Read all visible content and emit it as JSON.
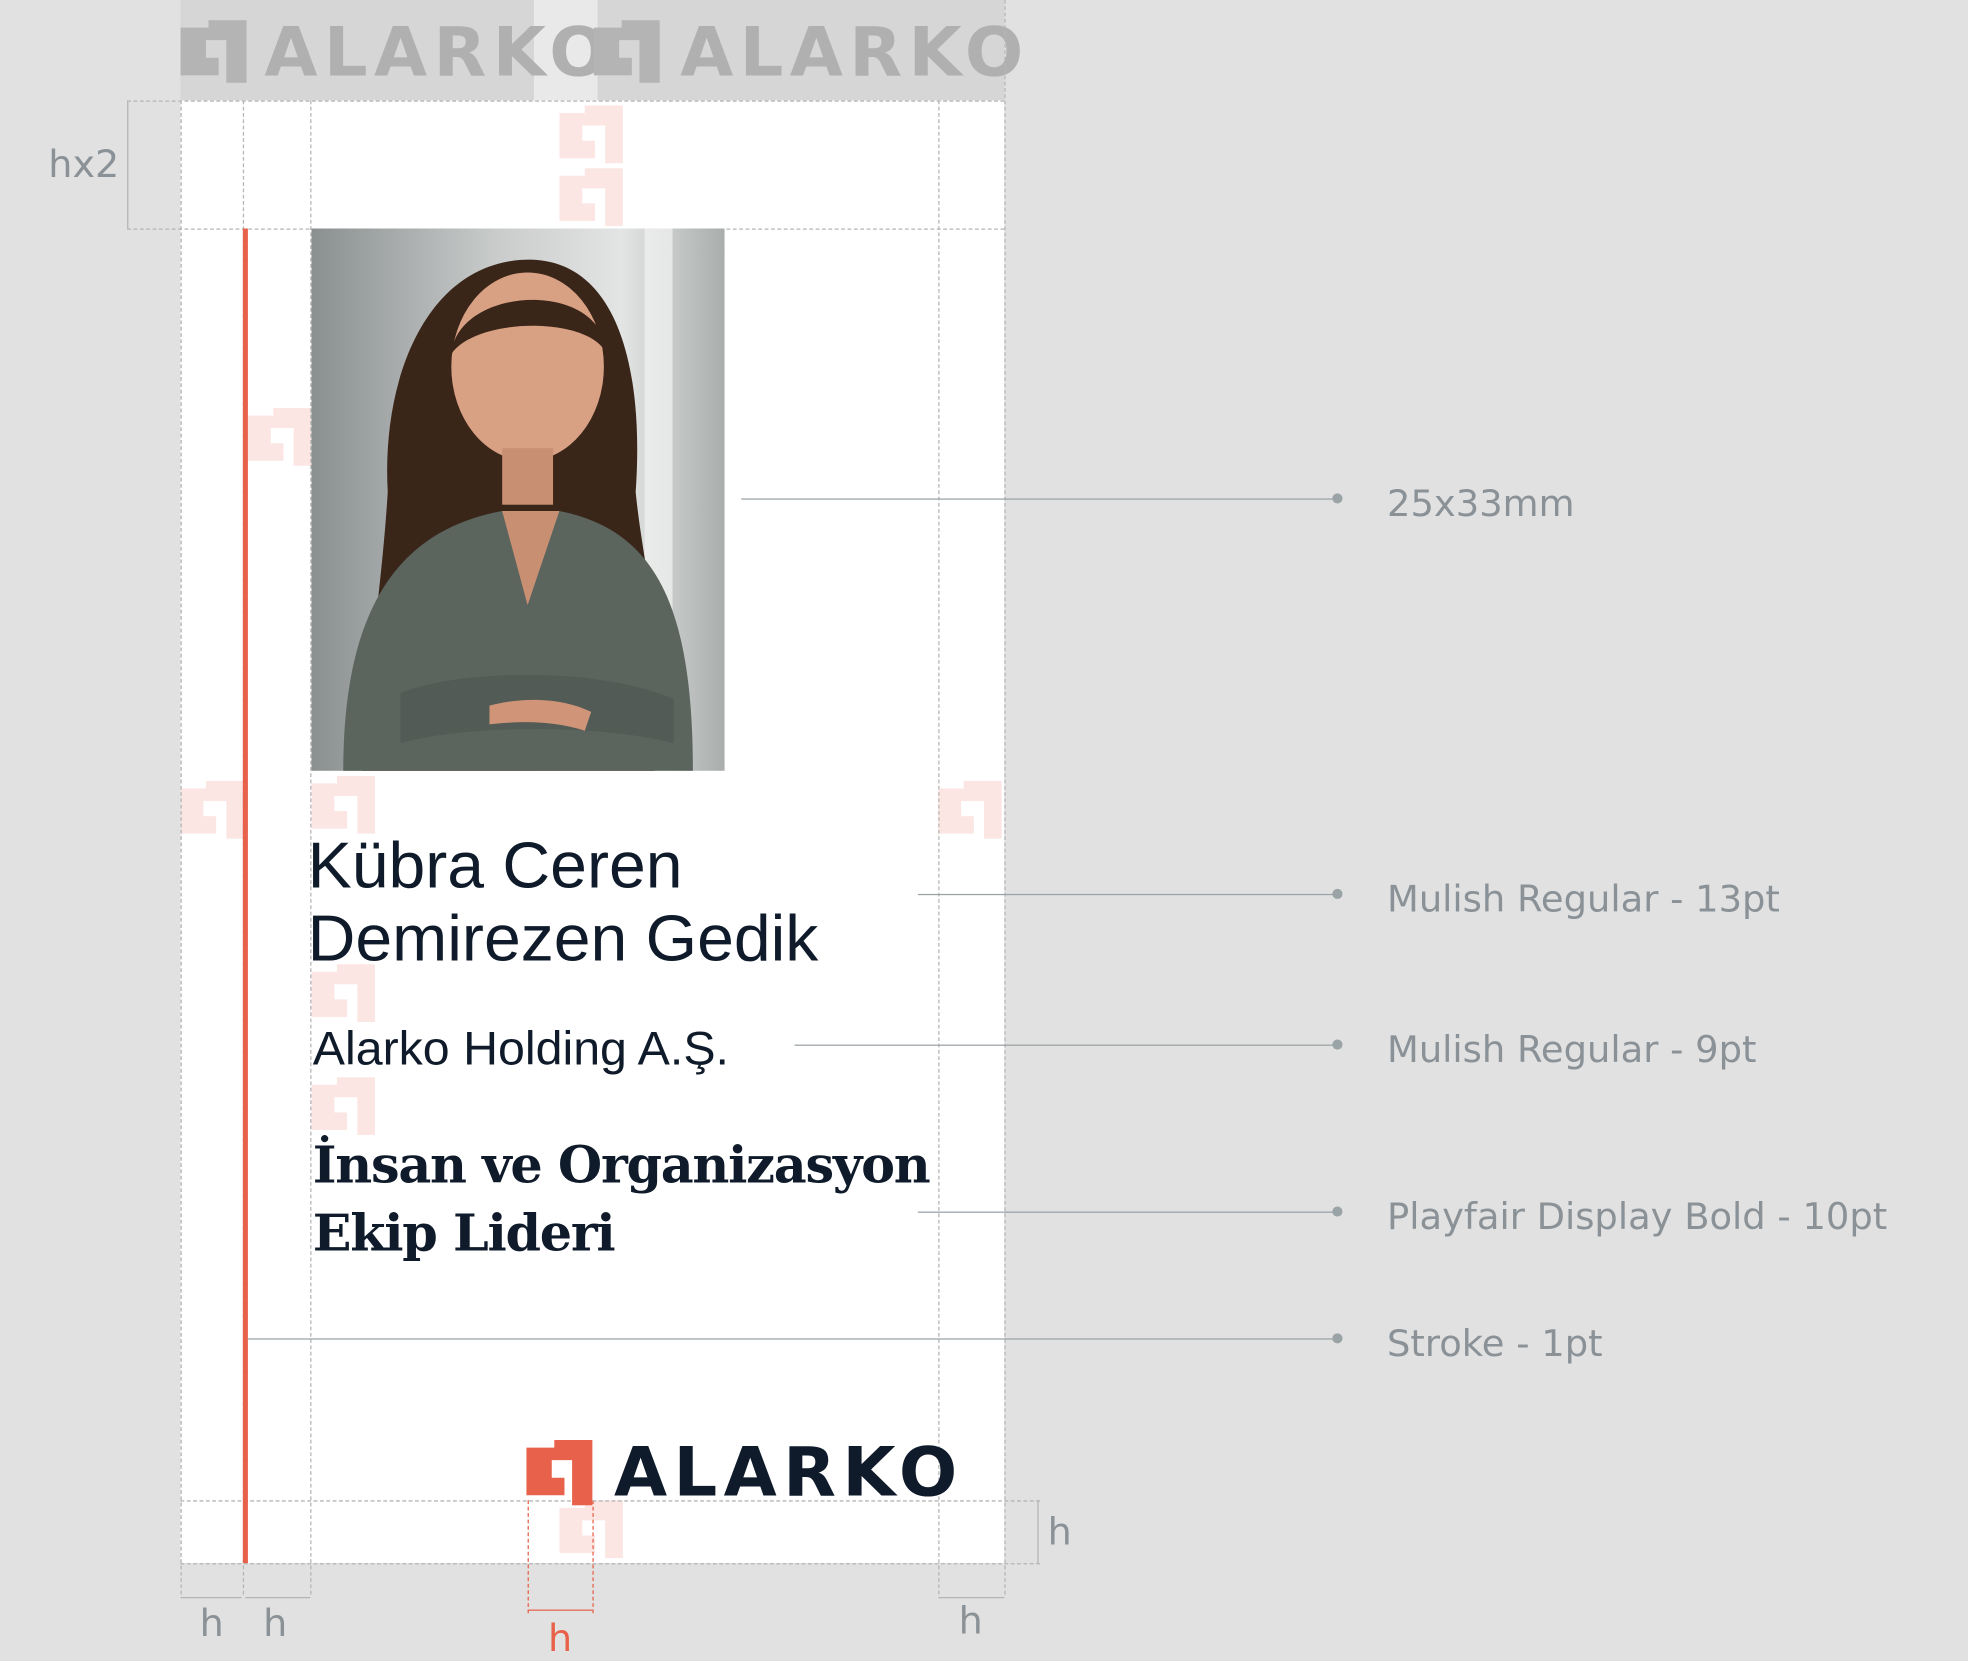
{
  "header_logos": [
    {
      "wordmark": "ALARKO",
      "icon": "alarko-mark-icon"
    },
    {
      "wordmark": "ALARKO",
      "icon": "alarko-mark-icon"
    }
  ],
  "card": {
    "name_line1": "Kübra Ceren",
    "name_line2": "Demirezen Gedik",
    "company": "Alarko Holding A.Ş.",
    "title_line1": "İnsan ve Organizasyon",
    "title_line2": "Ekip Lideri",
    "photo": "portrait-photo",
    "footer_logo": {
      "wordmark": "ALARKO",
      "icon": "alarko-mark-icon"
    }
  },
  "callouts": [
    {
      "label": "25x33mm"
    },
    {
      "label": "Mulish Regular - 13pt"
    },
    {
      "label": "Mulish Regular - 9pt"
    },
    {
      "label": "Playfair Display Bold - 10pt"
    },
    {
      "label": "Stroke - 1pt"
    }
  ],
  "dimensions": {
    "top_margin": "hx2",
    "bottom_margin": "h",
    "left_margin": "h",
    "stroke_gap": "h",
    "logo_width": "h",
    "right_margin": "h"
  },
  "colors": {
    "accent": "#e8614a",
    "text": "#0f1b2a",
    "annotation": "#8a9297",
    "background": "#e1e1e1"
  }
}
